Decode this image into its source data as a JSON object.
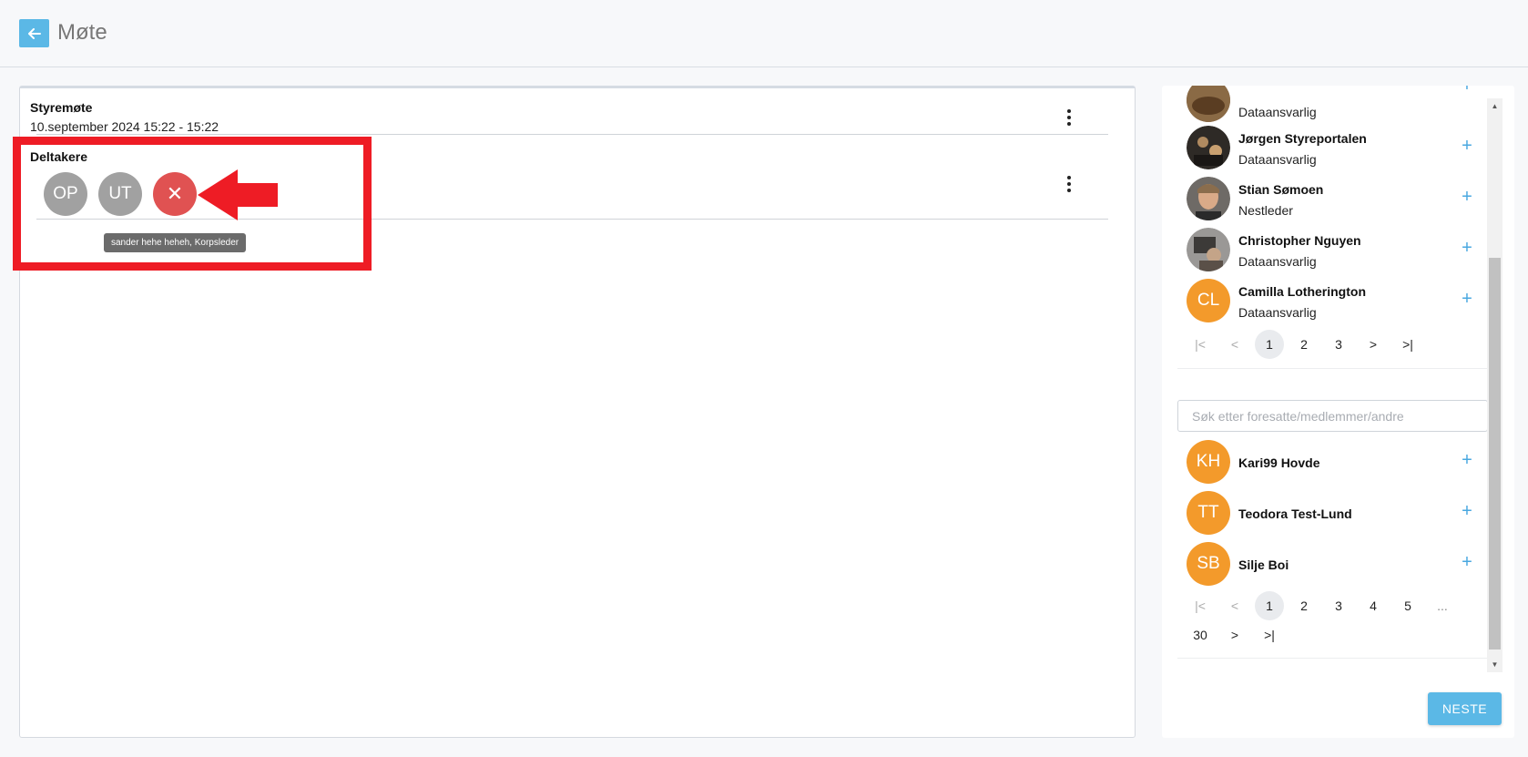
{
  "header": {
    "title": "Møte"
  },
  "meeting": {
    "title": "Styremøte",
    "date": "10.september 2024 15:22 - 15:22",
    "participants_label": "Deltakere",
    "participants": [
      {
        "initials": "OP"
      },
      {
        "initials": "UT"
      },
      {
        "initials": "✕"
      }
    ],
    "tooltip": "sander hehe heheh, Korpsleder"
  },
  "members": [
    {
      "name": "",
      "role": "Dataansvarlig",
      "avatar": "photo"
    },
    {
      "name": "Jørgen Styreportalen",
      "role": "Dataansvarlig",
      "avatar": "photo"
    },
    {
      "name": "Stian Sømoen",
      "role": "Nestleder",
      "avatar": "photo"
    },
    {
      "name": "Christopher Nguyen",
      "role": "Dataansvarlig",
      "avatar": "photo"
    },
    {
      "name": "Camilla Lotherington",
      "role": "Dataansvarlig",
      "initials": "CL"
    }
  ],
  "members_pagination": {
    "first": "|<",
    "prev": "<",
    "pages": [
      "1",
      "2",
      "3"
    ],
    "next": ">",
    "last": ">|",
    "active": "1"
  },
  "search": {
    "placeholder": "Søk etter foresatte/medlemmer/andre"
  },
  "results": [
    {
      "name": "Kari99 Hovde",
      "initials": "KH"
    },
    {
      "name": "Teodora Test-Lund",
      "initials": "TT"
    },
    {
      "name": "Silje Boi",
      "initials": "SB"
    }
  ],
  "results_pagination": {
    "pages": [
      "1",
      "2",
      "3",
      "4",
      "5"
    ],
    "ellipsis": "...",
    "last_page": "30",
    "active": "1"
  },
  "add_symbol": "+",
  "next_button": "NESTE",
  "colors": {
    "accent": "#5bb8e6",
    "avatar_orange": "#f39a2b",
    "avatar_grey": "#a1a1a1",
    "remove_red": "#e05252",
    "annotation_red": "#ee1c25"
  }
}
